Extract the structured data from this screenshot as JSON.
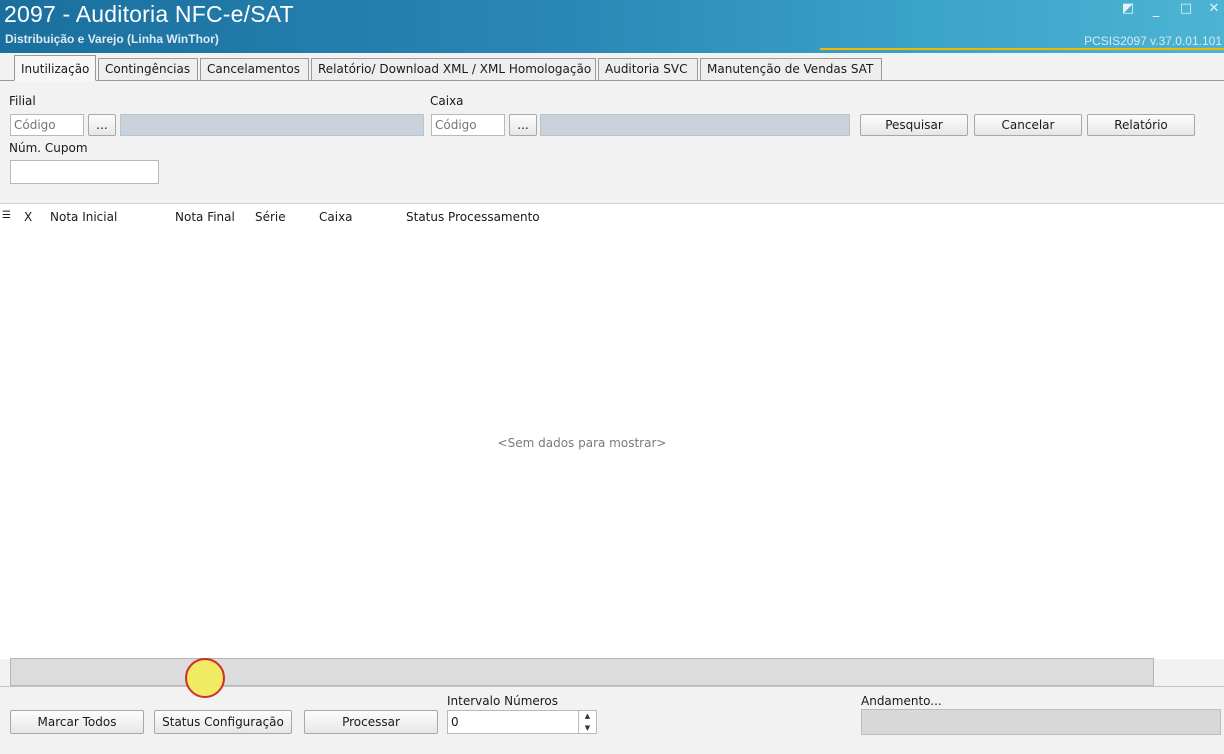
{
  "window": {
    "title": "2097 - Auditoria NFC-e/SAT",
    "subtitle": "Distribuição e Varejo (Linha WinThor)",
    "version": "PCSIS2097  v.37.0.01.101"
  },
  "tabs": [
    {
      "label": "Inutilização",
      "active": true
    },
    {
      "label": "Contingências",
      "active": false
    },
    {
      "label": "Cancelamentos",
      "active": false
    },
    {
      "label": "Relatório/ Download XML / XML Homologação",
      "active": false
    },
    {
      "label": "Auditoria SVC",
      "active": false
    },
    {
      "label": "Manutenção de Vendas SAT",
      "active": false
    }
  ],
  "filters": {
    "filial_label": "Filial",
    "filial_code_placeholder": "Código",
    "caixa_label": "Caixa",
    "caixa_code_placeholder": "Código",
    "lookup_button": "...",
    "cupom_label": "Núm. Cupom",
    "cupom_value": ""
  },
  "actions": {
    "pesquisar": "Pesquisar",
    "cancelar": "Cancelar",
    "relatorio": "Relatório"
  },
  "grid": {
    "columns": [
      "X",
      "Nota Inicial",
      "Nota Final",
      "Série",
      "Caixa",
      "Status Processamento"
    ],
    "empty_text": "<Sem dados para mostrar>"
  },
  "footer": {
    "marcar_todos": "Marcar Todos",
    "status_configuracao": "Status Configuração",
    "processar": "Processar",
    "intervalo_label": "Intervalo Números",
    "intervalo_value": "0",
    "andamento_label": "Andamento..."
  },
  "icons": {
    "minimize": "minimize-icon",
    "maximize": "maximize-icon",
    "close": "close-icon",
    "restore": "restore-icon",
    "grid_menu": "grid-menu-icon"
  }
}
